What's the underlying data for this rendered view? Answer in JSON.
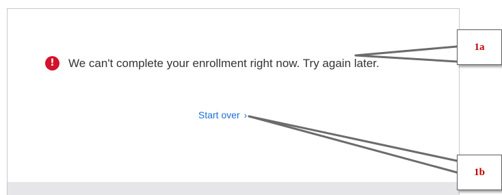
{
  "error": {
    "icon": "exclamation-circle-icon",
    "icon_glyph": "!",
    "message": "We can't complete your enrollment right now. Try again later.",
    "icon_color": "#d2132b"
  },
  "actions": {
    "start_over_label": "Start over",
    "start_over_chevron": "›",
    "link_color": "#1d6fd2"
  },
  "annotations": {
    "callout_1a": "1a",
    "callout_1b": "1b",
    "label_color": "#c00000"
  }
}
